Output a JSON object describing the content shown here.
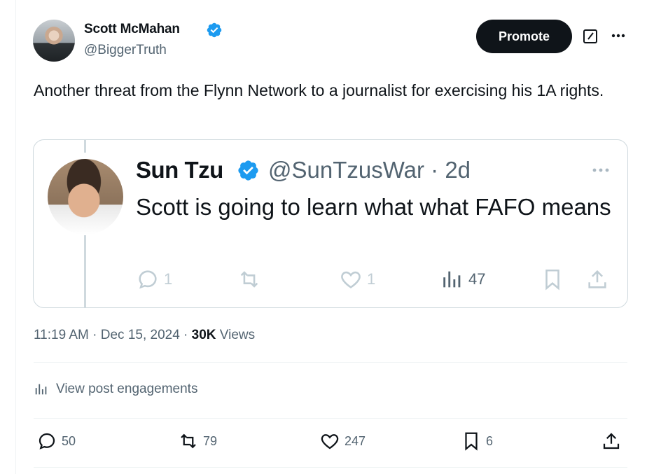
{
  "author": {
    "name": "Scott McMahan",
    "handle": "@BiggerTruth"
  },
  "header": {
    "promote_label": "Promote"
  },
  "tweet": {
    "text": "Another threat from the Flynn Network to a journalist for exercising his 1A rights."
  },
  "quoted": {
    "name": "Sun Tzu",
    "handle_time": "@SunTzusWar · 2d",
    "text": "Scott is going to learn what what FAFO means",
    "replies": "1",
    "likes": "1",
    "views": "47"
  },
  "meta": {
    "time_date": "11:19 AM · Dec 15, 2024 · ",
    "views_count": "30K",
    "views_label": " Views"
  },
  "engagements_label": "View post engagements",
  "actions": {
    "replies": "50",
    "reposts": "79",
    "likes": "247",
    "bookmarks": "6"
  },
  "colors": {
    "verified": "#1d9bf0",
    "text_primary": "#0f1419",
    "text_secondary": "#536471",
    "border": "#cfd9de"
  },
  "icons": [
    "verified-badge-icon",
    "edit-icon",
    "more-icon",
    "reply-icon",
    "repost-icon",
    "like-icon",
    "views-icon",
    "bookmark-icon",
    "share-icon"
  ]
}
